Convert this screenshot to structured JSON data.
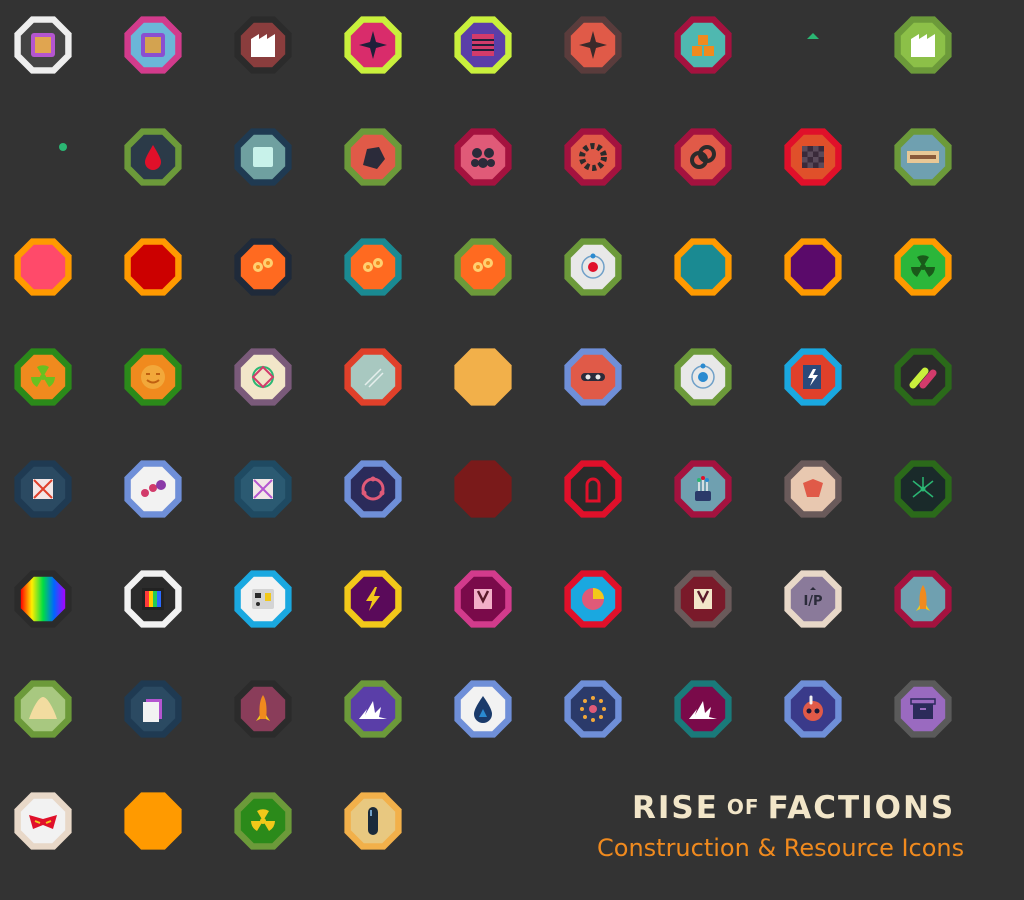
{
  "title": {
    "word1": "RISE",
    "word2": "OF",
    "word3": "FACTIONS"
  },
  "subtitle": "Construction & Resource Icons",
  "icons": [
    {
      "name": "circuit-chip-icon",
      "outer": "#eeeeee",
      "inner": "#444444",
      "glyph": "chip",
      "g": "#b455d0"
    },
    {
      "name": "rainbow-processor-icon",
      "outer": "#d23b8c",
      "inner": "#6bb6d8",
      "glyph": "chip",
      "g": "#8a4fd0"
    },
    {
      "name": "factory-building-icon",
      "outer": "#2b2b2b",
      "inner": "#8a3d3d",
      "glyph": "factory",
      "g": "#ffffff"
    },
    {
      "name": "star-compass-icon",
      "outer": "#c9f03c",
      "inner": "#d92c6b",
      "glyph": "star",
      "g": "#1f1f3a"
    },
    {
      "name": "striped-crate-icon",
      "outer": "#c9f03c",
      "inner": "#5a3ea8",
      "glyph": "crate",
      "g": "#d23b6b"
    },
    {
      "name": "compass-plate-icon",
      "outer": "#5a3c3c",
      "inner": "#e05a48",
      "glyph": "star",
      "g": "#3a2a2a"
    },
    {
      "name": "block-stack-icon",
      "outer": "#a4123f",
      "inner": "#4fb8b0",
      "glyph": "blocks",
      "g": "#f08a1e"
    },
    {
      "name": "small-arrow-icon",
      "outer": "transparent",
      "inner": "transparent",
      "glyph": "arrow",
      "g": "#2bb673"
    },
    {
      "name": "white-factory-icon",
      "outer": "#6c9a3a",
      "inner": "#8cc048",
      "glyph": "factory",
      "g": "#ffffff"
    },
    {
      "name": "dot-marker-icon",
      "outer": "transparent",
      "inner": "transparent",
      "glyph": "dot",
      "g": "#2bb673"
    },
    {
      "name": "blood-drop-icon",
      "outer": "#6c9a3a",
      "inner": "#2b3a48",
      "glyph": "drop",
      "g": "#e0102a"
    },
    {
      "name": "glass-panel-icon",
      "outer": "#1f3a52",
      "inner": "#6fa0a0",
      "glyph": "square",
      "g": "#c8f2ea"
    },
    {
      "name": "dark-ore-icon",
      "outer": "#6c9a3a",
      "inner": "#e05a48",
      "glyph": "ore",
      "g": "#2b2b3a"
    },
    {
      "name": "hex-mesh-icon",
      "outer": "#a4123f",
      "inner": "#e05a78",
      "glyph": "hexes",
      "g": "#2b2b3a"
    },
    {
      "name": "gear-cog-icon",
      "outer": "#a4123f",
      "inner": "#e05a48",
      "glyph": "gear",
      "g": "#2b2b2b"
    },
    {
      "name": "double-ring-icon",
      "outer": "#a4123f",
      "inner": "#e05a48",
      "glyph": "rings",
      "g": "#2b2b2b"
    },
    {
      "name": "checker-plate-icon",
      "outer": "#e0102a",
      "inner": "#e0502a",
      "glyph": "checker",
      "g": "#3a2a3a"
    },
    {
      "name": "cement-sign-icon",
      "outer": "#6c9a3a",
      "inner": "#6fa0b0",
      "glyph": "sign",
      "g": "#e8c896"
    },
    {
      "name": "pink-octagon-icon",
      "outer": "#ff9a00",
      "inner": "#ff4a6a",
      "glyph": "none",
      "g": "#ffffff"
    },
    {
      "name": "red-octagon-icon",
      "outer": "#ff9a00",
      "inner": "#cc0000",
      "glyph": "none",
      "g": "#ffffff"
    },
    {
      "name": "orange-flower-icon",
      "outer": "#1f2a3a",
      "inner": "#ff6a20",
      "glyph": "flowers",
      "g": "#ffd070"
    },
    {
      "name": "teal-flower-icon",
      "outer": "#1a8a92",
      "inner": "#ff6a20",
      "glyph": "flowers",
      "g": "#ffd070"
    },
    {
      "name": "green-flower-icon",
      "outer": "#6c9a3a",
      "inner": "#ff6a20",
      "glyph": "flowers",
      "g": "#ffd070"
    },
    {
      "name": "orbit-target-icon",
      "outer": "#6c9a3a",
      "inner": "#e8e8e8",
      "glyph": "orbit",
      "g": "#e0102a"
    },
    {
      "name": "teal-octagon-icon",
      "outer": "#ff9a00",
      "inner": "#1a8a92",
      "glyph": "none",
      "g": "#ffffff"
    },
    {
      "name": "purple-octagon-icon",
      "outer": "#ff9a00",
      "inner": "#5a0a6a",
      "glyph": "none",
      "g": "#ffffff"
    },
    {
      "name": "radiation-orange-icon",
      "outer": "#ff9a00",
      "inner": "#2bb63a",
      "glyph": "rad",
      "g": "#1a5a1a"
    },
    {
      "name": "radiation-green-icon",
      "outer": "#2b8a1a",
      "inner": "#f08a1e",
      "glyph": "rad",
      "g": "#6ac020"
    },
    {
      "name": "sun-face-icon",
      "outer": "#2b8a1a",
      "inner": "#f08a1e",
      "glyph": "face",
      "g": "#c06010"
    },
    {
      "name": "interlock-ring-icon",
      "outer": "#7a5a7a",
      "inner": "#f2e6c9",
      "glyph": "knot",
      "g": "#d23b6b"
    },
    {
      "name": "glass-sheet-icon",
      "outer": "#e0402a",
      "inner": "#a8c8c0",
      "glyph": "glass",
      "g": "#ffffff"
    },
    {
      "name": "plain-sand-octagon-icon",
      "outer": "#f2b04a",
      "inner": "#f2b04a",
      "glyph": "none",
      "g": "#ffffff"
    },
    {
      "name": "goggle-bot-icon",
      "outer": "#6f8fd8",
      "inner": "#e05a48",
      "glyph": "goggles",
      "g": "#2b2b3a"
    },
    {
      "name": "blue-orbit-icon",
      "outer": "#6c9a3a",
      "inner": "#e8e8e8",
      "glyph": "orbit",
      "g": "#2a8ad0"
    },
    {
      "name": "power-cell-icon",
      "outer": "#1aa8e0",
      "inner": "#e0402a",
      "glyph": "cell",
      "g": "#2b4a7a"
    },
    {
      "name": "color-pills-icon",
      "outer": "#2b6a1a",
      "inner": "#2b2b2b",
      "glyph": "pills",
      "g": "#d23b6b"
    },
    {
      "name": "crossed-box-icon",
      "outer": "#1f3a52",
      "inner": "#2b4a62",
      "glyph": "xbox",
      "g": "#e0402a"
    },
    {
      "name": "molecule-chain-icon",
      "outer": "#6f8fd8",
      "inner": "#f2f2f2",
      "glyph": "chain",
      "g": "#d23b6b"
    },
    {
      "name": "purple-crossbox-icon",
      "outer": "#1f4a62",
      "inner": "#2b5a72",
      "glyph": "xbox",
      "g": "#b455d0"
    },
    {
      "name": "atom-ring-icon",
      "outer": "#6f8fd8",
      "inner": "#2b2b5a",
      "glyph": "atomring",
      "g": "#e05a78"
    },
    {
      "name": "maroon-octagon-icon",
      "outer": "#7a1a1a",
      "inner": "#7a1a1a",
      "glyph": "none",
      "g": "#ffffff"
    },
    {
      "name": "red-capsule-pod-icon",
      "outer": "#e0102a",
      "inner": "#2b2b2b",
      "glyph": "pod",
      "g": "#e0102a"
    },
    {
      "name": "fiber-sprout-icon",
      "outer": "#a4123f",
      "inner": "#6fa0b0",
      "glyph": "sprout",
      "g": "#2b3a6a"
    },
    {
      "name": "tulip-crystal-icon",
      "outer": "#6a5a5a",
      "inner": "#e8c8b0",
      "glyph": "tulip",
      "g": "#e05a48"
    },
    {
      "name": "network-node-icon",
      "outer": "#2b6a1a",
      "inner": "#1a2a2a",
      "glyph": "network",
      "g": "#2bb673"
    },
    {
      "name": "rainbow-gem-icon",
      "outer": "#2b2b2b",
      "inner": "#ff3a3a",
      "glyph": "rainbow",
      "g": "#ffffff"
    },
    {
      "name": "rainbow-chip-icon",
      "outer": "#f2f2f2",
      "inner": "#2b2b2b",
      "glyph": "rainbowchip",
      "g": "#ffffff"
    },
    {
      "name": "control-panel-icon",
      "outer": "#1aa8e0",
      "inner": "#f2f2f2",
      "glyph": "panel",
      "g": "#2b2b2b"
    },
    {
      "name": "lightning-bolt-icon",
      "outer": "#f2c81a",
      "inner": "#5a0a5a",
      "glyph": "bolt",
      "g": "#f2c81a"
    },
    {
      "name": "magenta-insignia-icon",
      "outer": "#d23b8c",
      "inner": "#7a0a4a",
      "glyph": "insignia",
      "g": "#f2b0c8"
    },
    {
      "name": "pie-gauge-icon",
      "outer": "#e0102a",
      "inner": "#1aa8e0",
      "glyph": "pie",
      "g": "#f2c81a"
    },
    {
      "name": "maroon-insignia-icon",
      "outer": "#6a5a5a",
      "inner": "#7a1a2a",
      "glyph": "insignia",
      "g": "#f2e6c9"
    },
    {
      "name": "io-port-icon",
      "outer": "#e8d8c8",
      "inner": "#8a7a9a",
      "glyph": "text",
      "g": "#2b2b3a"
    },
    {
      "name": "rocket-launch-icon",
      "outer": "#a4123f",
      "inner": "#6fa0b0",
      "glyph": "rocket",
      "g": "#f08a1e"
    },
    {
      "name": "cream-mound-icon",
      "outer": "#6c9a3a",
      "inner": "#a8c880",
      "glyph": "mound",
      "g": "#f2dca0"
    },
    {
      "name": "stacked-sheets-icon",
      "outer": "#1f3a52",
      "inner": "#2b4a62",
      "glyph": "sheets",
      "g": "#f2f2f2"
    },
    {
      "name": "rocket-silo-icon",
      "outer": "#2b2b2b",
      "inner": "#8a3d5a",
      "glyph": "rocket",
      "g": "#f08a1e"
    },
    {
      "name": "purple-burst-icon",
      "outer": "#6c9a3a",
      "inner": "#5a3ea8",
      "glyph": "burst",
      "g": "#ffffff"
    },
    {
      "name": "blue-flame-drop-icon",
      "outer": "#6f8fd8",
      "inner": "#f2f2f2",
      "glyph": "flamedrop",
      "g": "#1a3a6a"
    },
    {
      "name": "spore-cluster-icon",
      "outer": "#6f8fd8",
      "inner": "#2b3a6a",
      "glyph": "spores",
      "g": "#e05a78"
    },
    {
      "name": "teal-burst-icon",
      "outer": "#1a7a7a",
      "inner": "#7a0a4a",
      "glyph": "burst",
      "g": "#ffffff"
    },
    {
      "name": "bomb-bot-icon",
      "outer": "#6f8fd8",
      "inner": "#3a3a8a",
      "glyph": "bombbot",
      "g": "#e05a48"
    },
    {
      "name": "storage-box-icon",
      "outer": "#5a5a5a",
      "inner": "#9a6ac0",
      "glyph": "box",
      "g": "#2b2b5a"
    },
    {
      "name": "red-mask-icon",
      "outer": "#e8d8c8",
      "inner": "#f2f2f2",
      "glyph": "mask",
      "g": "#e0102a"
    },
    {
      "name": "orange-octagon-icon",
      "outer": "#ff9a00",
      "inner": "#ff9a00",
      "glyph": "none",
      "g": "#ffffff"
    },
    {
      "name": "radiation-core-icon",
      "outer": "#6c9a3a",
      "inner": "#2b8a1a",
      "glyph": "rad",
      "g": "#f2c81a"
    },
    {
      "name": "fuel-rod-icon",
      "outer": "#f2b04a",
      "inner": "#e8c880",
      "glyph": "rod",
      "g": "#1a2a3a"
    }
  ]
}
